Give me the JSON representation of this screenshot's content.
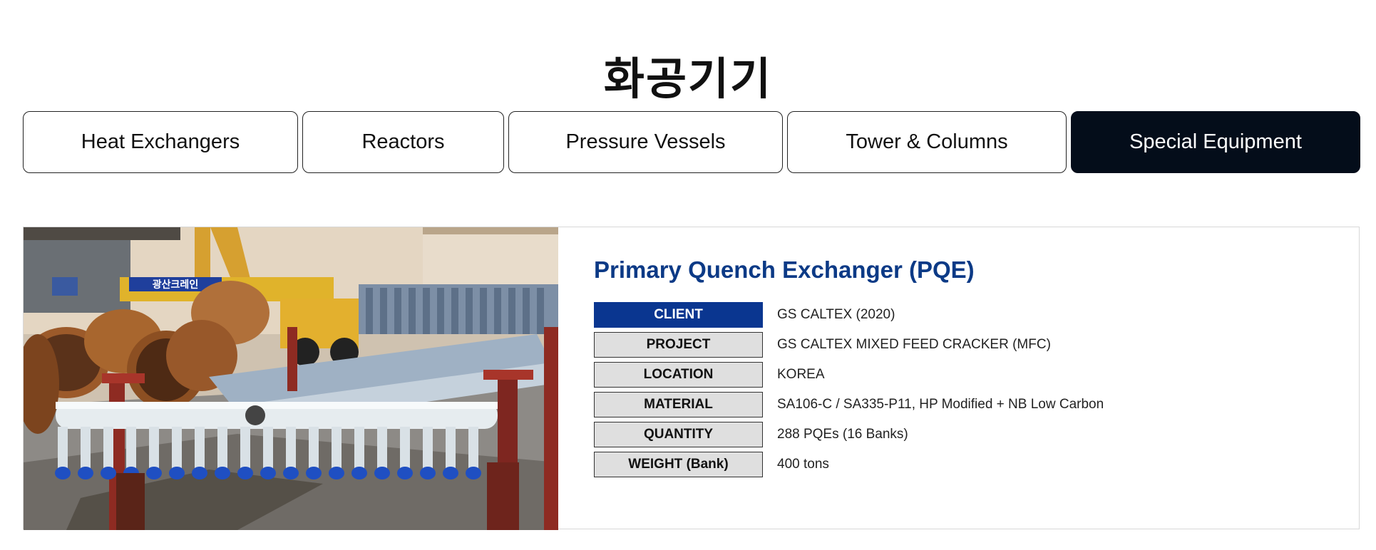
{
  "page": {
    "title": "화공기기"
  },
  "tabs": [
    {
      "label": "Heat Exchangers",
      "active": false
    },
    {
      "label": "Reactors",
      "active": false
    },
    {
      "label": "Pressure Vessels",
      "active": false
    },
    {
      "label": "Tower & Columns",
      "active": false
    },
    {
      "label": "Special Equipment",
      "active": true
    }
  ],
  "product": {
    "title": "Primary Quench Exchanger (PQE)",
    "image_sign_text": "광산크레인",
    "specs": [
      {
        "label": "CLIENT",
        "value": "GS CALTEX (2020)"
      },
      {
        "label": "PROJECT",
        "value": "GS CALTEX MIXED FEED CRACKER (MFC)"
      },
      {
        "label": "LOCATION",
        "value": "KOREA"
      },
      {
        "label": "MATERIAL",
        "value": "SA106-C / SA335-P11, HP Modified + NB Low Carbon"
      },
      {
        "label": "QUANTITY",
        "value": "288 PQEs (16 Banks)"
      },
      {
        "label": "WEIGHT (Bank)",
        "value": "400 tons"
      }
    ]
  },
  "colors": {
    "active_tab": "#040d1a",
    "title_blue": "#0c3a86",
    "client_label_bg": "#0a3690",
    "label_bg": "#dfdfdf"
  }
}
